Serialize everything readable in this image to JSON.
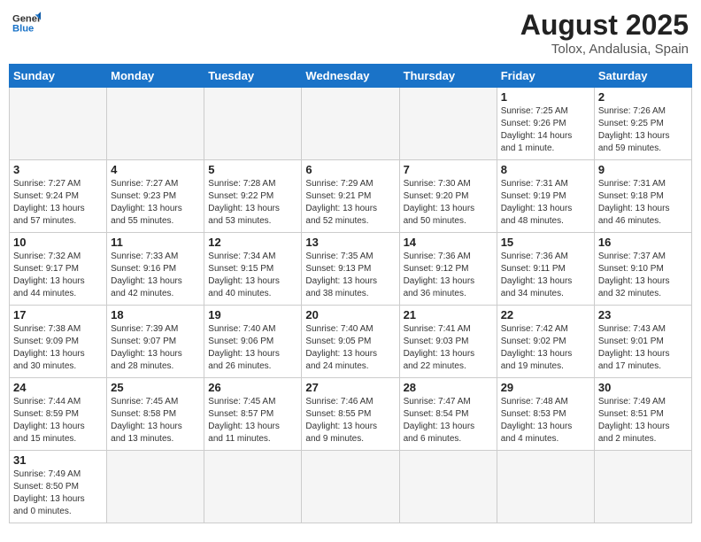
{
  "header": {
    "logo_general": "General",
    "logo_blue": "Blue",
    "title": "August 2025",
    "subtitle": "Tolox, Andalusia, Spain"
  },
  "weekdays": [
    "Sunday",
    "Monday",
    "Tuesday",
    "Wednesday",
    "Thursday",
    "Friday",
    "Saturday"
  ],
  "weeks": [
    [
      {
        "day": "",
        "info": ""
      },
      {
        "day": "",
        "info": ""
      },
      {
        "day": "",
        "info": ""
      },
      {
        "day": "",
        "info": ""
      },
      {
        "day": "",
        "info": ""
      },
      {
        "day": "1",
        "info": "Sunrise: 7:25 AM\nSunset: 9:26 PM\nDaylight: 14 hours\nand 1 minute."
      },
      {
        "day": "2",
        "info": "Sunrise: 7:26 AM\nSunset: 9:25 PM\nDaylight: 13 hours\nand 59 minutes."
      }
    ],
    [
      {
        "day": "3",
        "info": "Sunrise: 7:27 AM\nSunset: 9:24 PM\nDaylight: 13 hours\nand 57 minutes."
      },
      {
        "day": "4",
        "info": "Sunrise: 7:27 AM\nSunset: 9:23 PM\nDaylight: 13 hours\nand 55 minutes."
      },
      {
        "day": "5",
        "info": "Sunrise: 7:28 AM\nSunset: 9:22 PM\nDaylight: 13 hours\nand 53 minutes."
      },
      {
        "day": "6",
        "info": "Sunrise: 7:29 AM\nSunset: 9:21 PM\nDaylight: 13 hours\nand 52 minutes."
      },
      {
        "day": "7",
        "info": "Sunrise: 7:30 AM\nSunset: 9:20 PM\nDaylight: 13 hours\nand 50 minutes."
      },
      {
        "day": "8",
        "info": "Sunrise: 7:31 AM\nSunset: 9:19 PM\nDaylight: 13 hours\nand 48 minutes."
      },
      {
        "day": "9",
        "info": "Sunrise: 7:31 AM\nSunset: 9:18 PM\nDaylight: 13 hours\nand 46 minutes."
      }
    ],
    [
      {
        "day": "10",
        "info": "Sunrise: 7:32 AM\nSunset: 9:17 PM\nDaylight: 13 hours\nand 44 minutes."
      },
      {
        "day": "11",
        "info": "Sunrise: 7:33 AM\nSunset: 9:16 PM\nDaylight: 13 hours\nand 42 minutes."
      },
      {
        "day": "12",
        "info": "Sunrise: 7:34 AM\nSunset: 9:15 PM\nDaylight: 13 hours\nand 40 minutes."
      },
      {
        "day": "13",
        "info": "Sunrise: 7:35 AM\nSunset: 9:13 PM\nDaylight: 13 hours\nand 38 minutes."
      },
      {
        "day": "14",
        "info": "Sunrise: 7:36 AM\nSunset: 9:12 PM\nDaylight: 13 hours\nand 36 minutes."
      },
      {
        "day": "15",
        "info": "Sunrise: 7:36 AM\nSunset: 9:11 PM\nDaylight: 13 hours\nand 34 minutes."
      },
      {
        "day": "16",
        "info": "Sunrise: 7:37 AM\nSunset: 9:10 PM\nDaylight: 13 hours\nand 32 minutes."
      }
    ],
    [
      {
        "day": "17",
        "info": "Sunrise: 7:38 AM\nSunset: 9:09 PM\nDaylight: 13 hours\nand 30 minutes."
      },
      {
        "day": "18",
        "info": "Sunrise: 7:39 AM\nSunset: 9:07 PM\nDaylight: 13 hours\nand 28 minutes."
      },
      {
        "day": "19",
        "info": "Sunrise: 7:40 AM\nSunset: 9:06 PM\nDaylight: 13 hours\nand 26 minutes."
      },
      {
        "day": "20",
        "info": "Sunrise: 7:40 AM\nSunset: 9:05 PM\nDaylight: 13 hours\nand 24 minutes."
      },
      {
        "day": "21",
        "info": "Sunrise: 7:41 AM\nSunset: 9:03 PM\nDaylight: 13 hours\nand 22 minutes."
      },
      {
        "day": "22",
        "info": "Sunrise: 7:42 AM\nSunset: 9:02 PM\nDaylight: 13 hours\nand 19 minutes."
      },
      {
        "day": "23",
        "info": "Sunrise: 7:43 AM\nSunset: 9:01 PM\nDaylight: 13 hours\nand 17 minutes."
      }
    ],
    [
      {
        "day": "24",
        "info": "Sunrise: 7:44 AM\nSunset: 8:59 PM\nDaylight: 13 hours\nand 15 minutes."
      },
      {
        "day": "25",
        "info": "Sunrise: 7:45 AM\nSunset: 8:58 PM\nDaylight: 13 hours\nand 13 minutes."
      },
      {
        "day": "26",
        "info": "Sunrise: 7:45 AM\nSunset: 8:57 PM\nDaylight: 13 hours\nand 11 minutes."
      },
      {
        "day": "27",
        "info": "Sunrise: 7:46 AM\nSunset: 8:55 PM\nDaylight: 13 hours\nand 9 minutes."
      },
      {
        "day": "28",
        "info": "Sunrise: 7:47 AM\nSunset: 8:54 PM\nDaylight: 13 hours\nand 6 minutes."
      },
      {
        "day": "29",
        "info": "Sunrise: 7:48 AM\nSunset: 8:53 PM\nDaylight: 13 hours\nand 4 minutes."
      },
      {
        "day": "30",
        "info": "Sunrise: 7:49 AM\nSunset: 8:51 PM\nDaylight: 13 hours\nand 2 minutes."
      }
    ],
    [
      {
        "day": "31",
        "info": "Sunrise: 7:49 AM\nSunset: 8:50 PM\nDaylight: 13 hours\nand 0 minutes."
      },
      {
        "day": "",
        "info": ""
      },
      {
        "day": "",
        "info": ""
      },
      {
        "day": "",
        "info": ""
      },
      {
        "day": "",
        "info": ""
      },
      {
        "day": "",
        "info": ""
      },
      {
        "day": "",
        "info": ""
      }
    ]
  ]
}
